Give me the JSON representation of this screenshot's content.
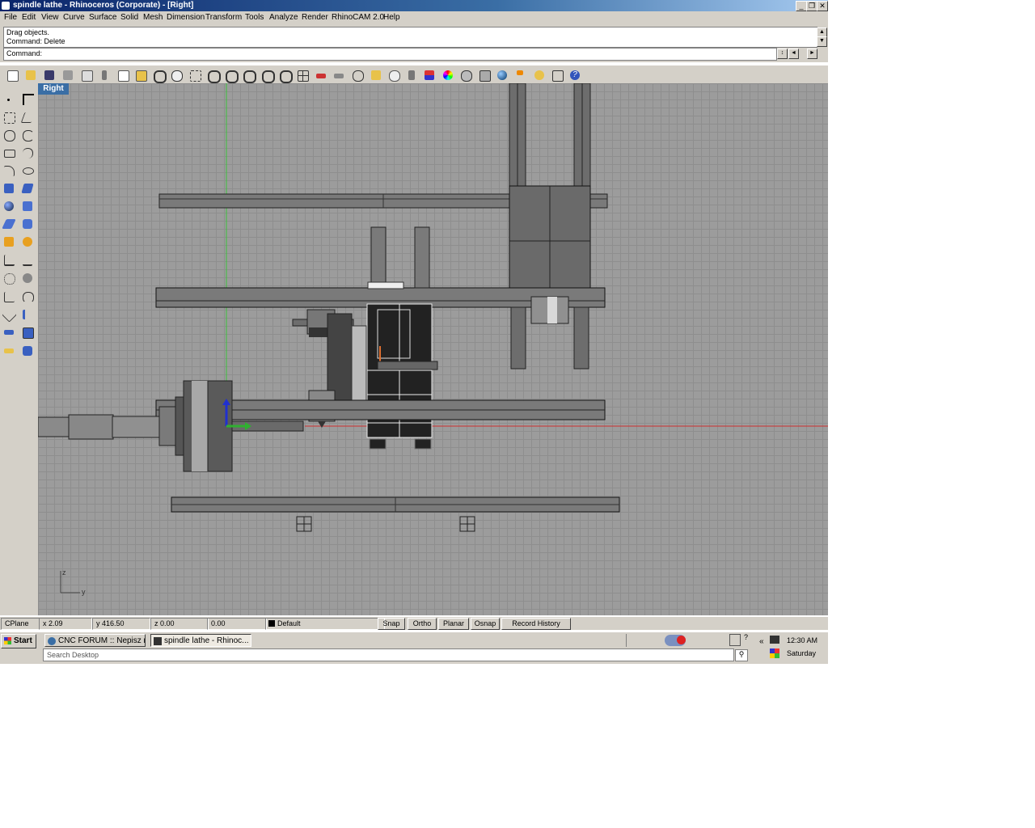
{
  "window": {
    "title": "spindle lathe - Rhinoceros (Corporate) - [Right]",
    "minimize": "_",
    "restore": "❐",
    "close": "✕"
  },
  "menu": {
    "items": [
      "File",
      "Edit",
      "View",
      "Curve",
      "Surface",
      "Solid",
      "Mesh",
      "Dimension",
      "Transform",
      "Tools",
      "Analyze",
      "Render",
      "RhinoCAM 2.0",
      "Help"
    ]
  },
  "command": {
    "history": [
      "Drag objects.",
      "Command: Delete"
    ],
    "prompt": "Command:"
  },
  "viewport": {
    "label": "Right",
    "axis_z": "z",
    "axis_y": "y"
  },
  "statusbar": {
    "cplane": "CPlane",
    "x": "x 2.09",
    "y": "y 416.50",
    "z": "z 0.00",
    "d": "0.00",
    "layer": "Default",
    "snap": "Snap",
    "ortho": "Ortho",
    "planar": "Planar",
    "osnap": "Osnap",
    "record_history": "Record History"
  },
  "taskbar": {
    "start": "Start",
    "tasks": [
      "CNC FORUM :: Nepisz no...",
      "spindle lathe - Rhinoc..."
    ],
    "search_placeholder": "Search Desktop",
    "clock": "12:30 AM",
    "day": "Saturday"
  },
  "icons": {
    "standard_toolbar": [
      "new-icon",
      "open-icon",
      "save-icon",
      "print-icon",
      "import-icon",
      "cut-icon",
      "copy-icon",
      "paste-icon",
      "undo-icon",
      "pan-icon",
      "rotate-icon",
      "zoom-window-icon",
      "zoom-dynamic-icon",
      "zoom-extents-icon",
      "zoom-selected-icon",
      "undo-view-icon",
      "four-viewports-icon",
      "car-icon",
      "car2-icon",
      "grid-snap-icon",
      "osnap-icon",
      "light-icon",
      "lock-icon",
      "layer-icon",
      "color-wheel-icon",
      "shade-icon",
      "wireframe-icon",
      "render-sphere-icon",
      "flag-icon",
      "options-icon",
      "toolbox-icon",
      "help-icon"
    ]
  }
}
